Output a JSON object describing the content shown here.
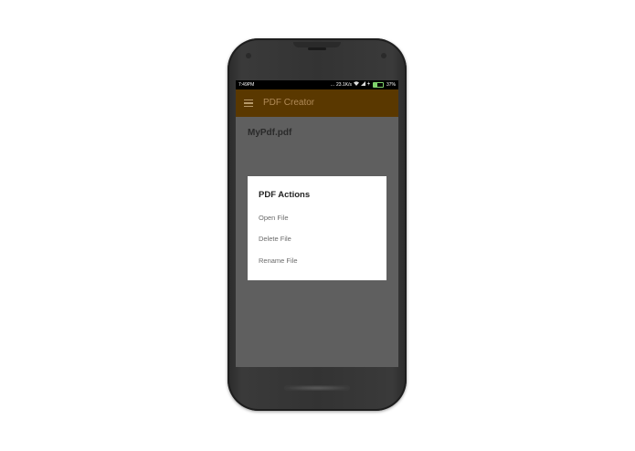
{
  "statusbar": {
    "time": "7:49PM",
    "dots": "...",
    "speed": "23.1K/s",
    "battery_percent": "37%",
    "battery_level": 0.37
  },
  "appbar": {
    "menu_icon": "hamburger-menu-icon",
    "title": "PDF Creator",
    "color": "#5a3800"
  },
  "main": {
    "file_name": "MyPdf.pdf"
  },
  "dialog": {
    "title": "PDF Actions",
    "items": [
      {
        "label": "Open File"
      },
      {
        "label": "Delete File"
      },
      {
        "label": "Rename File"
      }
    ]
  }
}
